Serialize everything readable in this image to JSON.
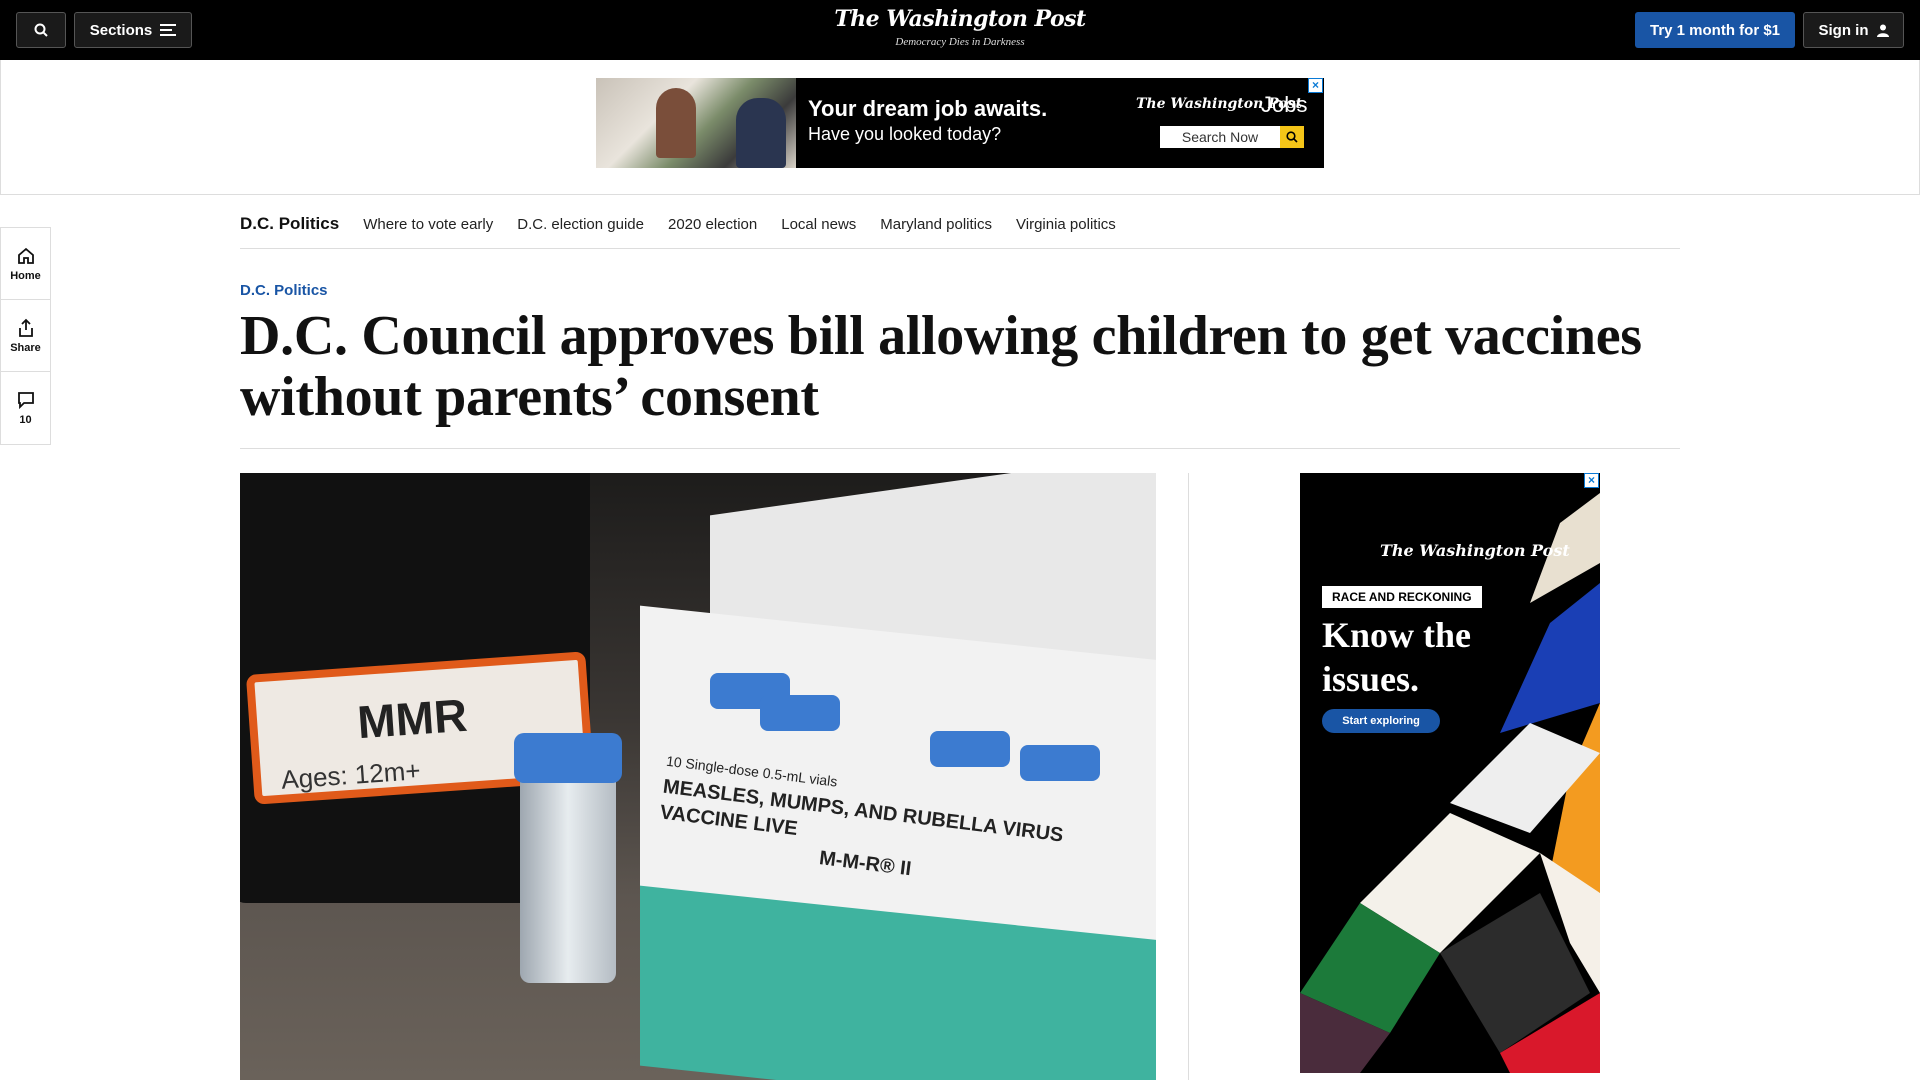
{
  "header": {
    "sections_label": "Sections",
    "logo": "The Washington Post",
    "tagline": "Democracy Dies in Darkness",
    "try_label": "Try 1 month for $1",
    "signin_label": "Sign in"
  },
  "top_ad": {
    "headline": "Your dream job awaits.",
    "sub": "Have you looked today?",
    "logo": "The Washington Post",
    "jobs": "Jobs",
    "search_label": "Search Now"
  },
  "rail": {
    "home": "Home",
    "share": "Share",
    "comments": "10"
  },
  "section_nav": {
    "title": "D.C. Politics",
    "links": [
      "Where to vote early",
      "D.C. election guide",
      "2020 election",
      "Local news",
      "Maryland politics",
      "Virginia politics"
    ]
  },
  "article": {
    "kicker": "D.C. Politics",
    "headline": "D.C. Council approves bill allowing children to get vaccines without parents’ consent"
  },
  "hero_image": {
    "bin_label": "MMR",
    "ages": "Ages: 12m+",
    "box_text": "MEASLES, MUMPS, AND RUBELLA VIRUS VACCINE LIVE",
    "box_sub": "M-M-R® II",
    "box_top": "10 Single-dose 0.5-mL vials"
  },
  "side_ad": {
    "logo": "The Washington Post",
    "tag": "RACE AND RECKONING",
    "headline": "Know the issues.",
    "cta": "Start exploring"
  },
  "colors": {
    "brand_blue": "#1955a5",
    "topbar": "#000000",
    "ad_close": "#0a7ad6"
  }
}
